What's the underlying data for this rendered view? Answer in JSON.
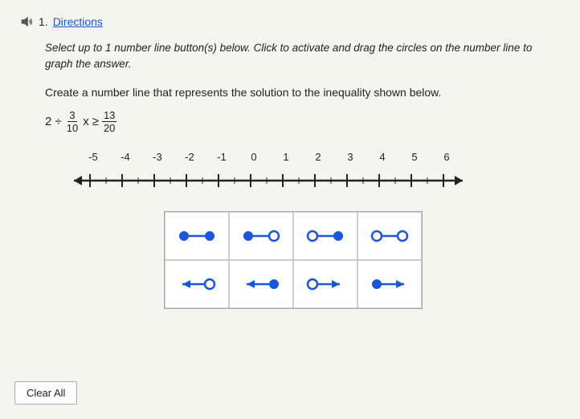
{
  "header": {
    "speaker_label": "speaker",
    "question_number": "1.",
    "directions_label": "Directions"
  },
  "instructions": "Select up to 1 number line button(s) below. Click to activate and drag the circles on the number line to graph the answer.",
  "problem": {
    "line1": "Create a number line that represents the solution to the inequality shown below.",
    "math": {
      "coeff": "2 ÷",
      "frac_num": "3",
      "frac_den": "10",
      "variable": "x",
      "geq": "≥",
      "rhs_num": "13",
      "rhs_den": "20"
    }
  },
  "number_line": {
    "labels": [
      "-5",
      "-4",
      "-3",
      "-2",
      "-1",
      "0",
      "1",
      "2",
      "3",
      "4",
      "5",
      "6"
    ]
  },
  "buttons": [
    {
      "id": "btn-filled-filled-right",
      "type": "filled-dot-line-filled-dot",
      "direction": "right"
    },
    {
      "id": "btn-filled-open-right",
      "type": "filled-dot-line-open-dot",
      "direction": "right"
    },
    {
      "id": "btn-open-filled-right",
      "type": "open-dot-line-filled-dot",
      "direction": "right"
    },
    {
      "id": "btn-open-open-right",
      "type": "open-dot-line-open-dot",
      "direction": "right"
    },
    {
      "id": "btn-arrow-left-open",
      "type": "arrow-left-open-dot",
      "direction": "left"
    },
    {
      "id": "btn-arrow-left-filled",
      "type": "arrow-left-filled-dot",
      "direction": "left"
    },
    {
      "id": "btn-open-arrow-right",
      "type": "open-dot-arrow-right",
      "direction": "right"
    },
    {
      "id": "btn-filled-arrow-right",
      "type": "filled-dot-arrow-right",
      "direction": "right"
    }
  ],
  "clear_all": {
    "label": "Clear All"
  },
  "colors": {
    "blue": "#1a56db",
    "dot_blue": "#1a56db",
    "line_blue": "#1a56db"
  }
}
